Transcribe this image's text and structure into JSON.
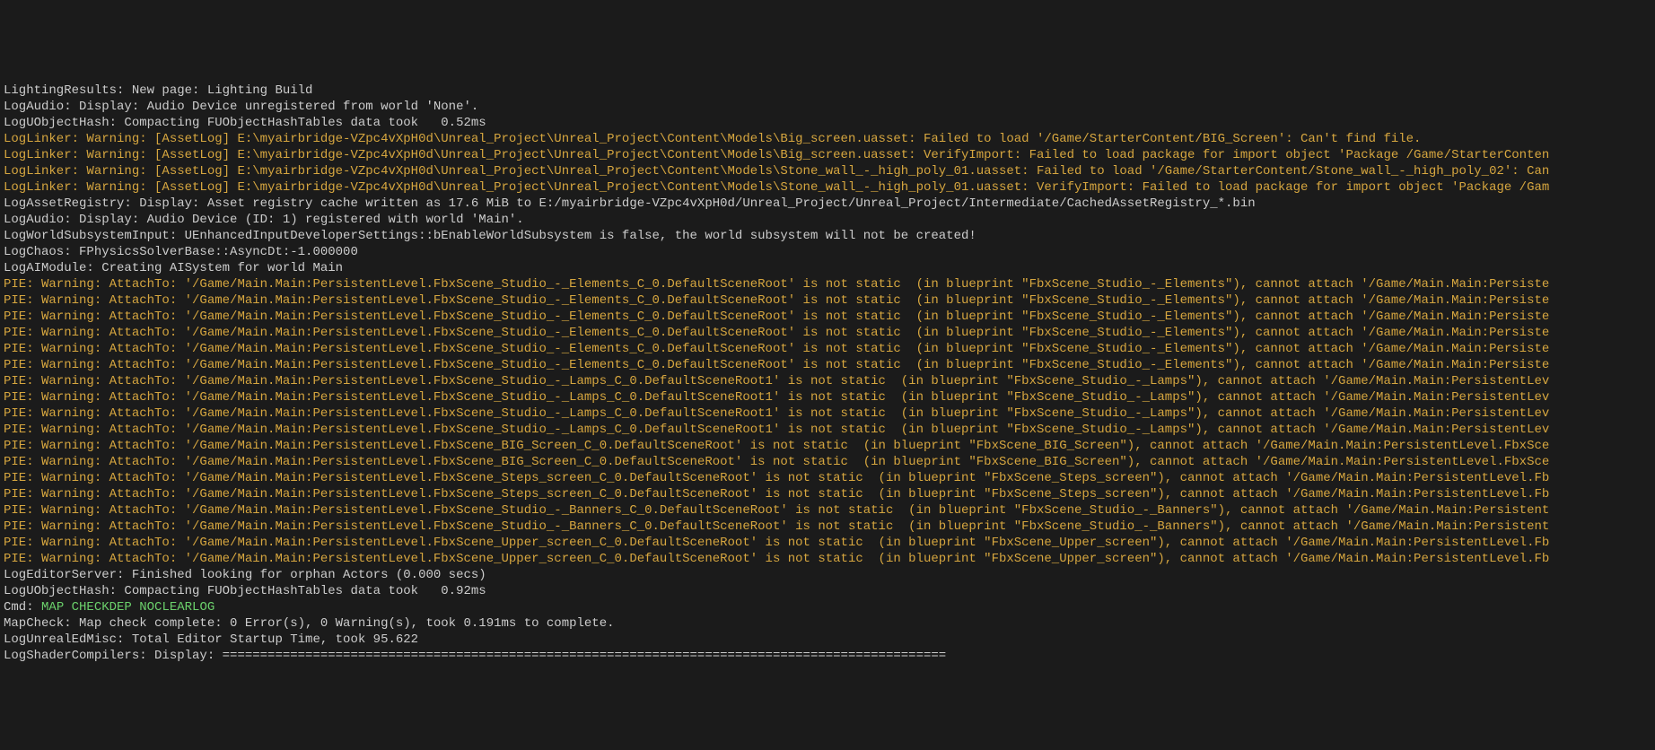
{
  "log_lines": [
    {
      "cls": "white",
      "text": "LightingResults: New page: Lighting Build"
    },
    {
      "cls": "white",
      "text": "LogAudio: Display: Audio Device unregistered from world 'None'."
    },
    {
      "cls": "white",
      "text": "LogUObjectHash: Compacting FUObjectHashTables data took   0.52ms"
    },
    {
      "cls": "warn",
      "text": "LogLinker: Warning: [AssetLog] E:\\myairbridge-VZpc4vXpH0d\\Unreal_Project\\Unreal_Project\\Content\\Models\\Big_screen.uasset: Failed to load '/Game/StarterContent/BIG_Screen': Can't find file."
    },
    {
      "cls": "warn",
      "text": "LogLinker: Warning: [AssetLog] E:\\myairbridge-VZpc4vXpH0d\\Unreal_Project\\Unreal_Project\\Content\\Models\\Big_screen.uasset: VerifyImport: Failed to load package for import object 'Package /Game/StarterConten"
    },
    {
      "cls": "warn",
      "text": "LogLinker: Warning: [AssetLog] E:\\myairbridge-VZpc4vXpH0d\\Unreal_Project\\Unreal_Project\\Content\\Models\\Stone_wall_-_high_poly_01.uasset: Failed to load '/Game/StarterContent/Stone_wall_-_high_poly_02': Can"
    },
    {
      "cls": "warn",
      "text": "LogLinker: Warning: [AssetLog] E:\\myairbridge-VZpc4vXpH0d\\Unreal_Project\\Unreal_Project\\Content\\Models\\Stone_wall_-_high_poly_01.uasset: VerifyImport: Failed to load package for import object 'Package /Gam"
    },
    {
      "cls": "white",
      "text": "LogAssetRegistry: Display: Asset registry cache written as 17.6 MiB to E:/myairbridge-VZpc4vXpH0d/Unreal_Project/Unreal_Project/Intermediate/CachedAssetRegistry_*.bin"
    },
    {
      "cls": "white",
      "text": "LogAudio: Display: Audio Device (ID: 1) registered with world 'Main'."
    },
    {
      "cls": "white",
      "text": "LogWorldSubsystemInput: UEnhancedInputDeveloperSettings::bEnableWorldSubsystem is false, the world subsystem will not be created!"
    },
    {
      "cls": "white",
      "text": "LogChaos: FPhysicsSolverBase::AsyncDt:-1.000000"
    },
    {
      "cls": "white",
      "text": "LogAIModule: Creating AISystem for world Main"
    },
    {
      "cls": "warn",
      "text": "PIE: Warning: AttachTo: '/Game/Main.Main:PersistentLevel.FbxScene_Studio_-_Elements_C_0.DefaultSceneRoot' is not static  (in blueprint \"FbxScene_Studio_-_Elements\"), cannot attach '/Game/Main.Main:Persiste"
    },
    {
      "cls": "warn",
      "text": "PIE: Warning: AttachTo: '/Game/Main.Main:PersistentLevel.FbxScene_Studio_-_Elements_C_0.DefaultSceneRoot' is not static  (in blueprint \"FbxScene_Studio_-_Elements\"), cannot attach '/Game/Main.Main:Persiste"
    },
    {
      "cls": "warn",
      "text": "PIE: Warning: AttachTo: '/Game/Main.Main:PersistentLevel.FbxScene_Studio_-_Elements_C_0.DefaultSceneRoot' is not static  (in blueprint \"FbxScene_Studio_-_Elements\"), cannot attach '/Game/Main.Main:Persiste"
    },
    {
      "cls": "warn",
      "text": "PIE: Warning: AttachTo: '/Game/Main.Main:PersistentLevel.FbxScene_Studio_-_Elements_C_0.DefaultSceneRoot' is not static  (in blueprint \"FbxScene_Studio_-_Elements\"), cannot attach '/Game/Main.Main:Persiste"
    },
    {
      "cls": "warn",
      "text": "PIE: Warning: AttachTo: '/Game/Main.Main:PersistentLevel.FbxScene_Studio_-_Elements_C_0.DefaultSceneRoot' is not static  (in blueprint \"FbxScene_Studio_-_Elements\"), cannot attach '/Game/Main.Main:Persiste"
    },
    {
      "cls": "warn",
      "text": "PIE: Warning: AttachTo: '/Game/Main.Main:PersistentLevel.FbxScene_Studio_-_Elements_C_0.DefaultSceneRoot' is not static  (in blueprint \"FbxScene_Studio_-_Elements\"), cannot attach '/Game/Main.Main:Persiste"
    },
    {
      "cls": "warn",
      "text": "PIE: Warning: AttachTo: '/Game/Main.Main:PersistentLevel.FbxScene_Studio_-_Lamps_C_0.DefaultSceneRoot1' is not static  (in blueprint \"FbxScene_Studio_-_Lamps\"), cannot attach '/Game/Main.Main:PersistentLev"
    },
    {
      "cls": "warn",
      "text": "PIE: Warning: AttachTo: '/Game/Main.Main:PersistentLevel.FbxScene_Studio_-_Lamps_C_0.DefaultSceneRoot1' is not static  (in blueprint \"FbxScene_Studio_-_Lamps\"), cannot attach '/Game/Main.Main:PersistentLev"
    },
    {
      "cls": "warn",
      "text": "PIE: Warning: AttachTo: '/Game/Main.Main:PersistentLevel.FbxScene_Studio_-_Lamps_C_0.DefaultSceneRoot1' is not static  (in blueprint \"FbxScene_Studio_-_Lamps\"), cannot attach '/Game/Main.Main:PersistentLev"
    },
    {
      "cls": "warn",
      "text": "PIE: Warning: AttachTo: '/Game/Main.Main:PersistentLevel.FbxScene_Studio_-_Lamps_C_0.DefaultSceneRoot1' is not static  (in blueprint \"FbxScene_Studio_-_Lamps\"), cannot attach '/Game/Main.Main:PersistentLev"
    },
    {
      "cls": "warn",
      "text": "PIE: Warning: AttachTo: '/Game/Main.Main:PersistentLevel.FbxScene_BIG_Screen_C_0.DefaultSceneRoot' is not static  (in blueprint \"FbxScene_BIG_Screen\"), cannot attach '/Game/Main.Main:PersistentLevel.FbxSce"
    },
    {
      "cls": "warn",
      "text": "PIE: Warning: AttachTo: '/Game/Main.Main:PersistentLevel.FbxScene_BIG_Screen_C_0.DefaultSceneRoot' is not static  (in blueprint \"FbxScene_BIG_Screen\"), cannot attach '/Game/Main.Main:PersistentLevel.FbxSce"
    },
    {
      "cls": "warn",
      "text": "PIE: Warning: AttachTo: '/Game/Main.Main:PersistentLevel.FbxScene_Steps_screen_C_0.DefaultSceneRoot' is not static  (in blueprint \"FbxScene_Steps_screen\"), cannot attach '/Game/Main.Main:PersistentLevel.Fb"
    },
    {
      "cls": "warn",
      "text": "PIE: Warning: AttachTo: '/Game/Main.Main:PersistentLevel.FbxScene_Steps_screen_C_0.DefaultSceneRoot' is not static  (in blueprint \"FbxScene_Steps_screen\"), cannot attach '/Game/Main.Main:PersistentLevel.Fb"
    },
    {
      "cls": "warn",
      "text": "PIE: Warning: AttachTo: '/Game/Main.Main:PersistentLevel.FbxScene_Studio_-_Banners_C_0.DefaultSceneRoot' is not static  (in blueprint \"FbxScene_Studio_-_Banners\"), cannot attach '/Game/Main.Main:Persistent"
    },
    {
      "cls": "warn",
      "text": "PIE: Warning: AttachTo: '/Game/Main.Main:PersistentLevel.FbxScene_Studio_-_Banners_C_0.DefaultSceneRoot' is not static  (in blueprint \"FbxScene_Studio_-_Banners\"), cannot attach '/Game/Main.Main:Persistent"
    },
    {
      "cls": "warn",
      "text": "PIE: Warning: AttachTo: '/Game/Main.Main:PersistentLevel.FbxScene_Upper_screen_C_0.DefaultSceneRoot' is not static  (in blueprint \"FbxScene_Upper_screen\"), cannot attach '/Game/Main.Main:PersistentLevel.Fb"
    },
    {
      "cls": "warn",
      "text": "PIE: Warning: AttachTo: '/Game/Main.Main:PersistentLevel.FbxScene_Upper_screen_C_0.DefaultSceneRoot' is not static  (in blueprint \"FbxScene_Upper_screen\"), cannot attach '/Game/Main.Main:PersistentLevel.Fb"
    },
    {
      "cls": "white",
      "text": "LogEditorServer: Finished looking for orphan Actors (0.000 secs)"
    },
    {
      "cls": "white",
      "text": "LogUObjectHash: Compacting FUObjectHashTables data took   0.92ms"
    },
    {
      "cls": "cmd",
      "prefix": "Cmd: ",
      "cmd": "MAP CHECKDEP NOCLEARLOG"
    },
    {
      "cls": "white",
      "text": "MapCheck: Map check complete: 0 Error(s), 0 Warning(s), took 0.191ms to complete."
    },
    {
      "cls": "white",
      "text": "LogUnrealEdMisc: Total Editor Startup Time, took 95.622"
    },
    {
      "cls": "white",
      "text": "LogShaderCompilers: Display: ================================================================================================"
    }
  ]
}
